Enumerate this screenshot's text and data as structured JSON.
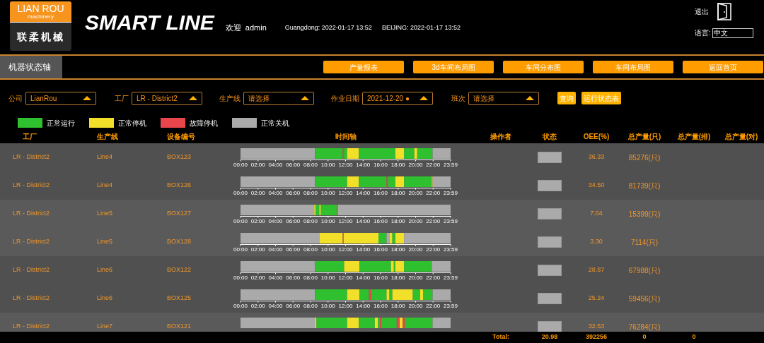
{
  "header": {
    "logo": {
      "title": "LIAN ROU",
      "subtitle": "machinery",
      "chinese": "联柔机械"
    },
    "app_title": "SMART LINE",
    "welcome": "欢迎",
    "user": "admin",
    "clocks": [
      "Guangdong: 2022-01-17 13:52",
      "BEIJING: 2022-01-17 13:52"
    ],
    "logout": "退出",
    "language_label": "语言:",
    "language": "中文"
  },
  "nav": {
    "page_tab": "机器状态轴",
    "buttons": [
      "产量报表",
      "3d车间布局图",
      "车间分布图",
      "车间布局图",
      "返回首页"
    ]
  },
  "filters": [
    {
      "label": "公司",
      "value": "LianRou"
    },
    {
      "label": "工厂",
      "value": "LR - District2"
    },
    {
      "label": "生产线",
      "value": "请选择"
    },
    {
      "label": "作业日期",
      "value": "2021-12-20 ●"
    },
    {
      "label": "班次",
      "value": "请选择"
    }
  ],
  "actions": [
    "查询",
    "运行状态表"
  ],
  "legend": [
    {
      "label": "正常运行",
      "color": "#2ec02e"
    },
    {
      "label": "正常停机",
      "color": "#f2df2a"
    },
    {
      "label": "故障停机",
      "color": "#e8454c"
    },
    {
      "label": "正常关机",
      "color": "#aaaaaa"
    }
  ],
  "columns": [
    "工厂",
    "生产线",
    "设备编号",
    "时间轴",
    "操作者",
    "状态",
    "OEE(%)",
    "总产量(只)",
    "总产量(排)",
    "总产量(对)"
  ],
  "rows": [
    {
      "factory": "LR - District2",
      "line": "Line4",
      "device": "BOX123",
      "ticks": [
        "00:00",
        "02:00",
        "04:00",
        "06:00",
        "08:00",
        "10:00",
        "12:00",
        "14:00",
        "16:00",
        "18:00",
        "20:00",
        "22:00",
        "23:59"
      ],
      "oee": "36.33",
      "total": "85276(只)"
    },
    {
      "factory": "LR - District2",
      "line": "Line4",
      "device": "BOX126",
      "ticks": [
        "00:00",
        "02:00",
        "04:00",
        "06:00",
        "08:00",
        "10:00",
        "12:00",
        "14:00",
        "16:00",
        "18:00",
        "20:00",
        "22:00",
        "23:59"
      ],
      "oee": "34.50",
      "total": "81739(只)"
    },
    {
      "factory": "LR - District2",
      "line": "Line5",
      "device": "BOX127",
      "ticks": [
        "00:00",
        "02:00",
        "04:00",
        "06:00",
        "08:00",
        "10:00",
        "12:00",
        "14:00",
        "16:00",
        "18:00",
        "20:00",
        "22:00",
        "23:59"
      ],
      "oee": "7.04",
      "total": "15399(只)"
    },
    {
      "factory": "LR - District2",
      "line": "Line5",
      "device": "BOX128",
      "ticks": [
        "00:00",
        "02:00",
        "04:00",
        "06:00",
        "08:00",
        "10:00",
        "12:00",
        "14:00",
        "16:00",
        "18:00",
        "20:00",
        "22:00",
        "23:59"
      ],
      "oee": "3.30",
      "total": "7114(只)"
    },
    {
      "factory": "LR - District2",
      "line": "Line6",
      "device": "BOX122",
      "ticks": [
        "00:00",
        "02:00",
        "04:00",
        "06:00",
        "08:00",
        "10:00",
        "12:00",
        "14:00",
        "16:00",
        "18:00",
        "20:00",
        "22:00",
        "23:59"
      ],
      "oee": "28.87",
      "total": "67988(只)"
    },
    {
      "factory": "LR - District2",
      "line": "Line6",
      "device": "BOX125",
      "ticks": [
        "00:00",
        "02:00",
        "04:00",
        "06:00",
        "08:00",
        "10:00",
        "12:00",
        "14:00",
        "16:00",
        "18:00",
        "20:00",
        "22:00",
        "23:59"
      ],
      "oee": "25.24",
      "total": "59456(只)"
    },
    {
      "factory": "LR - District2",
      "line": "Line7",
      "device": "BOX121",
      "oee": "32.53",
      "total": "76284(只)"
    }
  ],
  "totals": {
    "label": "Total:",
    "oee": "20.98",
    "count": "392256",
    "rows_count": "0",
    "pairs": "0"
  }
}
